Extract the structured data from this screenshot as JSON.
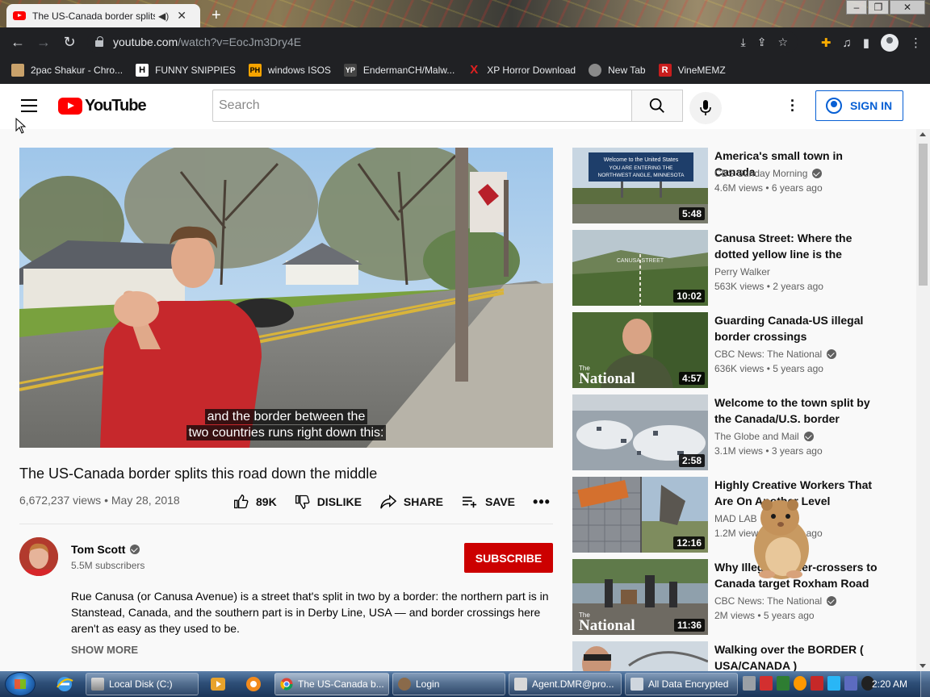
{
  "browser": {
    "tab_title": "The US-Canada border splits",
    "new_tab_label": "+",
    "url_host": "youtube.com",
    "url_path": "/watch?v=EocJm3Dry4E",
    "bookmarks": [
      {
        "label": "2pac Shakur - Chro...",
        "icon_color": "#c9a26b"
      },
      {
        "label": "FUNNY SNIPPIES",
        "icon_text": "H",
        "icon_color": "#ffffff"
      },
      {
        "label": "windows ISOS",
        "icon_text": "PH",
        "icon_color": "#f7a400"
      },
      {
        "label": "EndermanCH/Malw...",
        "icon_text": "YP",
        "icon_color": "#444444"
      },
      {
        "label": "XP Horror Download",
        "icon_text": "X",
        "icon_color": "#d11a1a"
      },
      {
        "label": "New Tab",
        "icon_color": "#8a8a8a"
      },
      {
        "label": "VineMEMZ",
        "icon_text": "R",
        "icon_color": "#c81d1d"
      }
    ]
  },
  "header": {
    "logo_text": "YouTube",
    "search_placeholder": "Search",
    "sign_in_label": "SIGN IN"
  },
  "video": {
    "caption_line1": "and the border between the",
    "caption_line2": "two countries runs right down this:",
    "title": "The US-Canada border splits this road down the middle",
    "views": "6,672,237 views",
    "date": "May 28, 2018",
    "likes": "89K",
    "dislike_label": "DISLIKE",
    "share_label": "SHARE",
    "save_label": "SAVE",
    "channel_name": "Tom Scott",
    "subscribers": "5.5M subscribers",
    "subscribe_label": "SUBSCRIBE",
    "description": "Rue Canusa (or Canusa Avenue) is a street that's split in two by a border: the northern part is in Stanstead, Canada, and the southern part is in Derby Line, USA — and border crossings here aren't as easy as they used to be.",
    "show_more_label": "SHOW MORE"
  },
  "recommendations": [
    {
      "title": "America's small town in Canada",
      "channel": "CBS Sunday Morning",
      "verified": true,
      "views": "4.6M views",
      "age": "6 years ago",
      "duration": "5:48",
      "thumb_text": [
        "Welcome to the United States",
        "YOU ARE ENTERING THE",
        "NORTHWEST ANGLE, MINNESOTA"
      ]
    },
    {
      "title": "Canusa Street: Where the dotted yellow line is the officia...",
      "channel": "Perry Walker",
      "verified": false,
      "views": "563K views",
      "age": "2 years ago",
      "duration": "10:02",
      "thumb_text": [
        "CANUSA STREET"
      ]
    },
    {
      "title": "Guarding Canada-US illegal border crossings",
      "channel": "CBC News: The National",
      "verified": true,
      "views": "636K views",
      "age": "5 years ago",
      "duration": "4:57",
      "thumb_text": [
        "The",
        "National"
      ]
    },
    {
      "title": "Welcome to the town split by the Canada/U.S. border",
      "channel": "The Globe and Mail",
      "verified": true,
      "views": "3.1M views",
      "age": "3 years ago",
      "duration": "2:58"
    },
    {
      "title": "Highly Creative Workers That Are On Another Level",
      "channel": "MAD LAB",
      "verified": false,
      "views": "1.2M views",
      "age": "3 years ago",
      "duration": "12:16"
    },
    {
      "title": "Why Illegal border-crossers to Canada target Roxham Road",
      "channel": "CBC News: The National",
      "verified": true,
      "views": "2M views",
      "age": "5 years ago",
      "duration": "11:36",
      "thumb_text": [
        "The",
        "National"
      ]
    },
    {
      "title": "Walking over the BORDER ( USA/CANADA )",
      "channel": "",
      "verified": false,
      "views": "",
      "age": "",
      "duration": ""
    }
  ],
  "taskbar": {
    "tasks": [
      {
        "label": "Local Disk (C:)",
        "active": false
      },
      {
        "label": "The US-Canada b...",
        "active": true
      },
      {
        "label": "Login",
        "active": false
      },
      {
        "label": "Agent.DMR@pro...",
        "active": false
      },
      {
        "label": "All Data Encrypted",
        "active": false
      }
    ],
    "clock": "2:20 AM"
  },
  "colors": {
    "yt_red": "#ff0000",
    "subscribe_red": "#cc0000",
    "link_blue": "#065fd4",
    "chrome_dark": "#202124"
  }
}
